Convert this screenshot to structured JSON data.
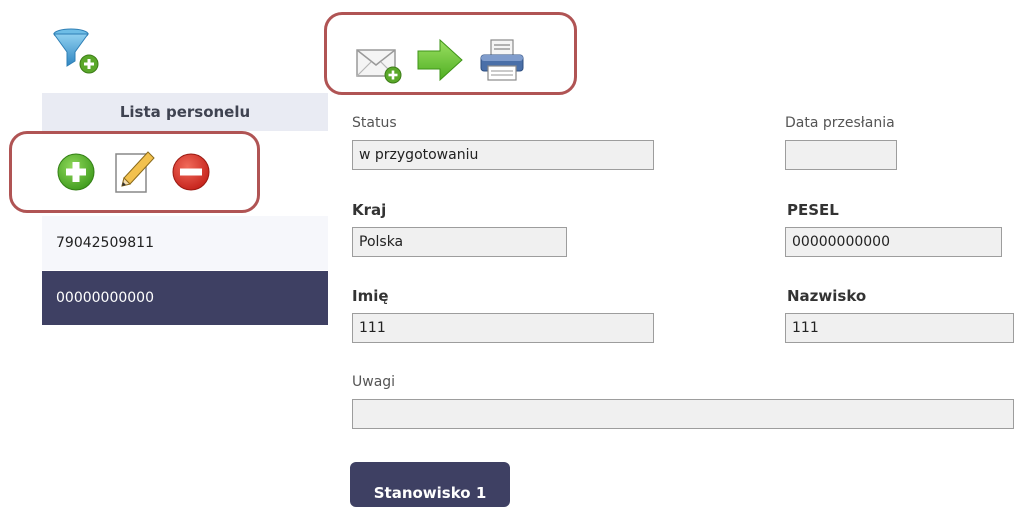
{
  "toolbar_icons": {
    "filter_add": "filter-add-icon",
    "send_message": "envelope-add-icon",
    "forward": "arrow-right-icon",
    "print": "printer-icon"
  },
  "sidebar": {
    "title": "Lista personelu",
    "actions": [
      "add-icon",
      "edit-icon",
      "remove-icon"
    ],
    "items": [
      {
        "label": "79042509811"
      },
      {
        "label": "00000000000"
      }
    ]
  },
  "form": {
    "status": {
      "label": "Status",
      "value": "w przygotowaniu"
    },
    "data_przeslania": {
      "label": "Data przesłania",
      "value": ""
    },
    "kraj": {
      "label": "Kraj",
      "value": "Polska"
    },
    "pesel": {
      "label": "PESEL",
      "value": "00000000000"
    },
    "imie": {
      "label": "Imię",
      "value": "111"
    },
    "nazwisko": {
      "label": "Nazwisko",
      "value": "111"
    },
    "uwagi": {
      "label": "Uwagi",
      "value": ""
    }
  },
  "tabs": [
    {
      "label": "Stanowisko 1"
    }
  ],
  "colors": {
    "highlight_border": "#b05454",
    "selected_row": "#3e4063",
    "sidebar_header": "#e9ebf3",
    "add_green": "#5aa82a",
    "remove_red": "#d9302a",
    "arrow_green": "#6cc43a"
  }
}
